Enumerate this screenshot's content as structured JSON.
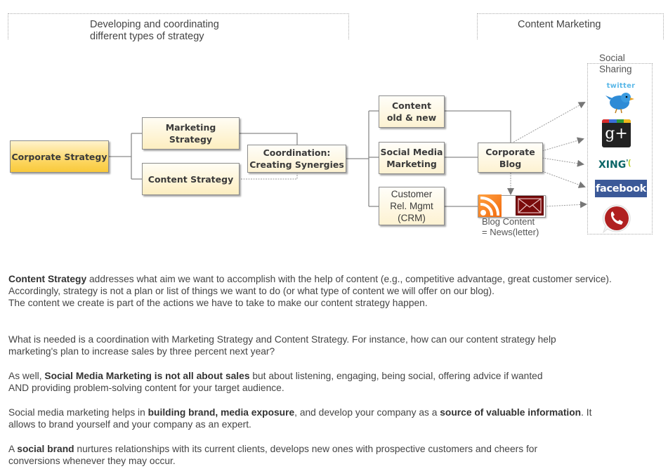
{
  "headers": {
    "left": "Developing and coordinating\ndifferent types of strategy",
    "right": "Content Marketing"
  },
  "nodes": {
    "corporate_strategy": "Corporate Strategy",
    "marketing_strategy": "Marketing Strategy",
    "content_strategy": "Content Strategy",
    "coordination": "Coordination:\nCreating Synergies",
    "content_old_new": "Content\nold & new",
    "social_media_marketing": "Social Media\nMarketing",
    "crm": "Customer\nRel. Mgmt\n(CRM)",
    "corporate_blog": "Corporate\nBlog"
  },
  "blog_content_label": "Blog Content\n= News(letter)",
  "social_sharing": {
    "label": "Social\nSharing",
    "icons": [
      {
        "name": "twitter-icon",
        "text": "twitter",
        "color": "#3aa4e0"
      },
      {
        "name": "google-plus-icon",
        "text": "g+",
        "color": "#222222"
      },
      {
        "name": "xing-icon",
        "text": "XING",
        "color": "#0a6567"
      },
      {
        "name": "facebook-icon",
        "text": "facebook",
        "color": "#3b5998"
      },
      {
        "name": "phone-icon",
        "text": "",
        "color": "#b02020"
      }
    ]
  },
  "rss_icon": {
    "name": "rss-icon",
    "color": "#f7941e"
  },
  "mail_icon": {
    "name": "mail-icon",
    "color": "#7a0b0b"
  },
  "paragraphs": [
    {
      "bold": "Content Strategy",
      "text": " addresses what aim we want to accomplish with the help of content (e.g., competitive advantage, great customer service). Accordingly, strategy is not a plan or list of things we want to do (or what type of content we will offer on our blog).",
      "line2": "The content we create is part of the actions we have to take to make our content strategy happen."
    },
    {
      "text": "What is needed is a coordination with Marketing Strategy and Content Strategy. For instance, how can our content strategy help marketing's plan to increase sales by three percent next year?"
    },
    {
      "pre": "As well, ",
      "bold": "Social Media Marketing is not all about sales",
      "text": " but about listening, engaging, being social, offering advice if wanted AND providing problem-solving content for your target audience."
    },
    {
      "pre": "Social media marketing helps in ",
      "bold": "building brand, media exposure",
      "mid": ", and develop your company as a ",
      "bold2": "source of valuable information",
      "text": ". It allows to brand yourself and your company as an expert."
    },
    {
      "pre": "A ",
      "bold": "social brand",
      "text": " nurtures relationships with its current clients, develops new ones with prospective customers and cheers for conversions whenever they may occur."
    }
  ]
}
